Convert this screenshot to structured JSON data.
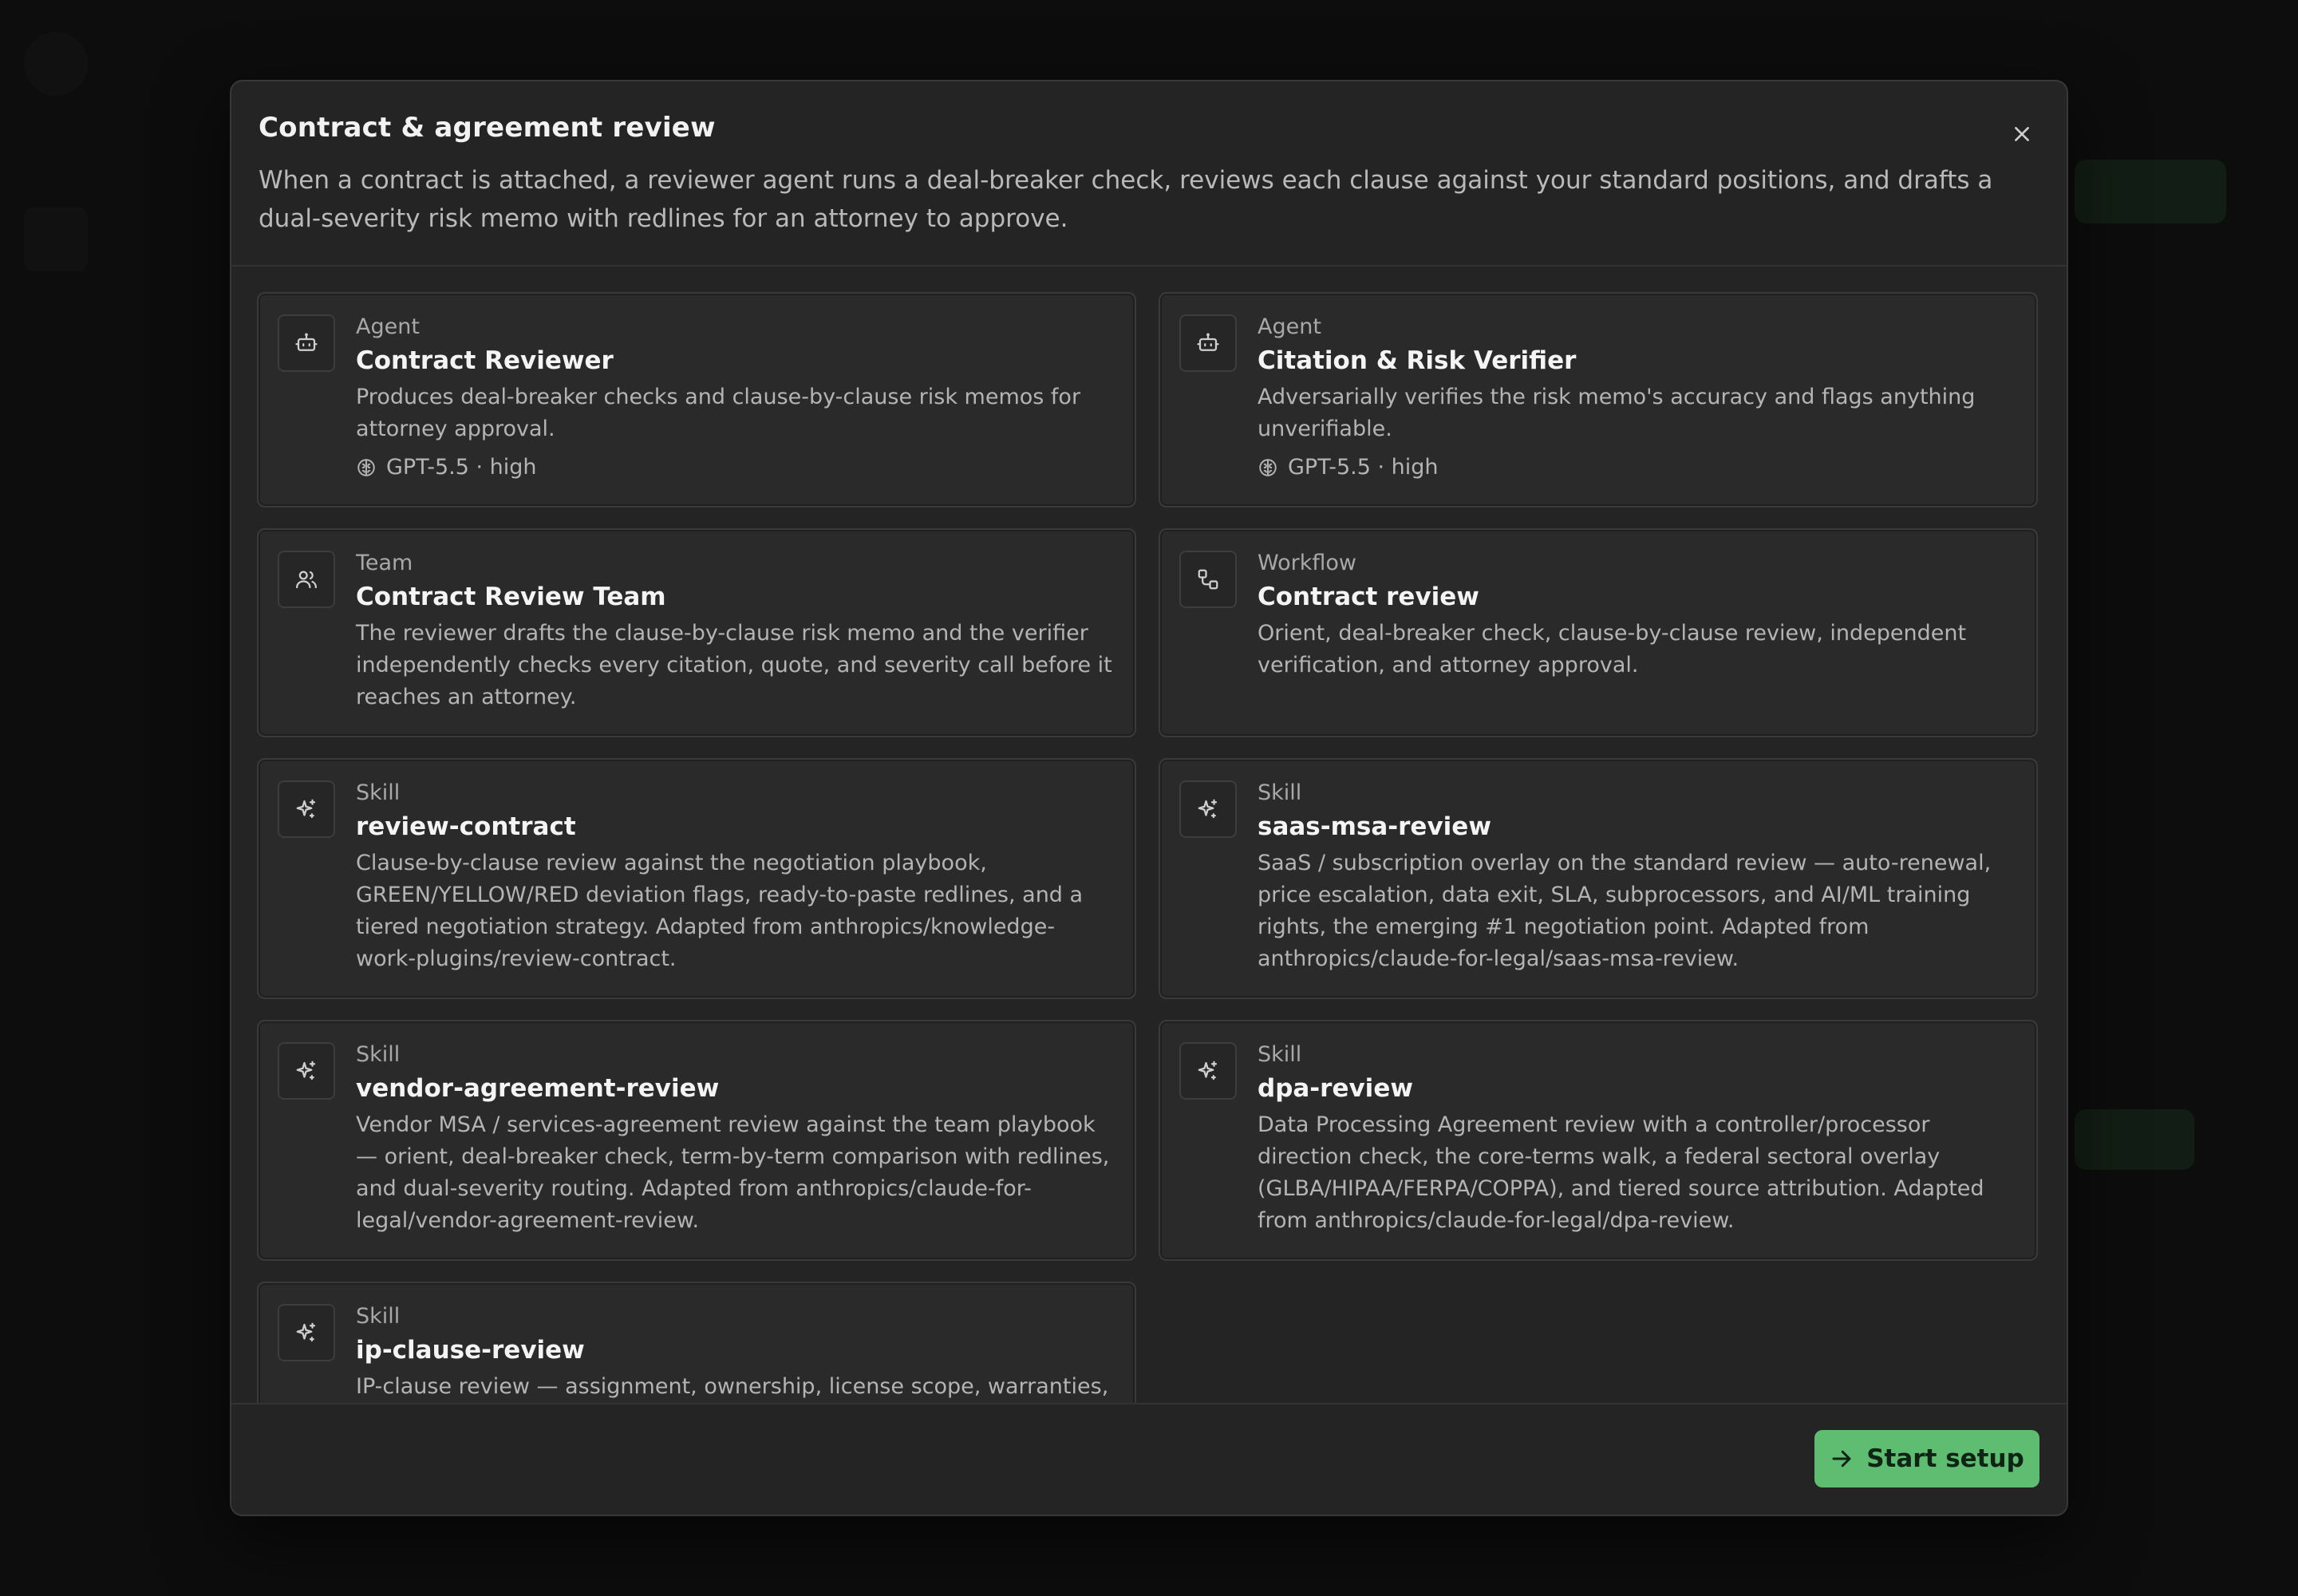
{
  "modal": {
    "title": "Contract & agreement review",
    "description": "When a contract is attached, a reviewer agent runs a deal-breaker check, reviews each clause against your standard positions, and drafts a dual-severity risk memo with redlines for an attorney to approve.",
    "close_icon": "close-icon",
    "start_button_label": "Start setup",
    "start_button_icon": "arrow-right-icon"
  },
  "cards": [
    {
      "kind": "Agent",
      "icon": "bot-icon",
      "name": "Contract Reviewer",
      "description": "Produces deal-breaker checks and clause-by-clause risk memos for attorney approval.",
      "model": "GPT-5.5 · high"
    },
    {
      "kind": "Agent",
      "icon": "bot-icon",
      "name": "Citation & Risk Verifier",
      "description": "Adversarially verifies the risk memo's accuracy and flags anything unverifiable.",
      "model": "GPT-5.5 · high"
    },
    {
      "kind": "Team",
      "icon": "users-icon",
      "name": "Contract Review Team",
      "description": "The reviewer drafts the clause-by-clause risk memo and the verifier independently checks every citation, quote, and severity call before it reaches an attorney."
    },
    {
      "kind": "Workflow",
      "icon": "workflow-icon",
      "name": "Contract review",
      "description": "Orient, deal-breaker check, clause-by-clause review, independent verification, and attorney approval."
    },
    {
      "kind": "Skill",
      "icon": "sparkles-icon",
      "name": "review-contract",
      "description": "Clause-by-clause review against the negotiation playbook, GREEN/YELLOW/RED deviation flags, ready-to-paste redlines, and a tiered negotiation strategy. Adapted from anthropics/knowledge-work-plugins/review-contract."
    },
    {
      "kind": "Skill",
      "icon": "sparkles-icon",
      "name": "saas-msa-review",
      "description": "SaaS / subscription overlay on the standard review — auto-renewal, price escalation, data exit, SLA, subprocessors, and AI/ML training rights, the emerging #1 negotiation point. Adapted from anthropics/claude-for-legal/saas-msa-review."
    },
    {
      "kind": "Skill",
      "icon": "sparkles-icon",
      "name": "vendor-agreement-review",
      "description": "Vendor MSA / services-agreement review against the team playbook — orient, deal-breaker check, term-by-term comparison with redlines, and dual-severity routing. Adapted from anthropics/claude-for-legal/vendor-agreement-review."
    },
    {
      "kind": "Skill",
      "icon": "sparkles-icon",
      "name": "dpa-review",
      "description": "Data Processing Agreement review with a controller/processor direction check, the core-terms walk, a federal sectoral overlay (GLBA/HIPAA/FERPA/COPPA), and tiered source attribution. Adapted from anthropics/claude-for-legal/dpa-review."
    },
    {
      "kind": "Skill",
      "icon": "sparkles-icon",
      "name": "ip-clause-review",
      "description": "IP-clause review — assignment, ownership, license scope, warranties, and"
    }
  ]
}
